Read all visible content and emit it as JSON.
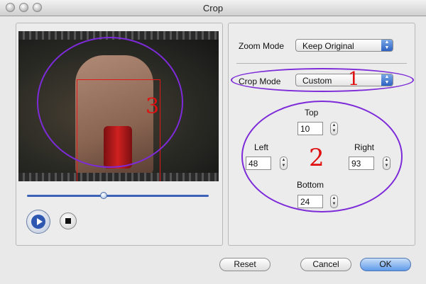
{
  "window": {
    "title": "Crop"
  },
  "zoom_mode": {
    "label": "Zoom Mode",
    "value": "Keep Original"
  },
  "crop_mode": {
    "label": "Crop Mode",
    "value": "Custom"
  },
  "crop": {
    "top": {
      "label": "Top",
      "value": "10"
    },
    "left": {
      "label": "Left",
      "value": "48"
    },
    "right": {
      "label": "Right",
      "value": "93"
    },
    "bottom": {
      "label": "Bottom",
      "value": "24"
    }
  },
  "buttons": {
    "reset": "Reset",
    "cancel": "Cancel",
    "ok": "OK"
  },
  "annotations": {
    "one": "1",
    "two": "2",
    "three": "3"
  },
  "colors": {
    "annotation": "#7d2bd9",
    "number": "#e01010",
    "accent": "#2d62c2"
  },
  "icons": [
    "play-icon",
    "stop-icon",
    "chevron-updown-icon",
    "stepper-icon"
  ]
}
